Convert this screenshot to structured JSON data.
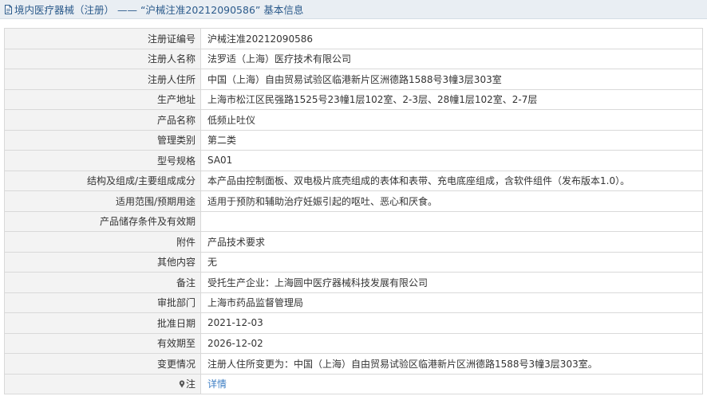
{
  "header": {
    "title": "境内医疗器械（注册） —— “沪械注准20212090586” 基本信息",
    "icon": "document-icon"
  },
  "rows": [
    {
      "label": "注册证编号",
      "value": "沪械注准20212090586"
    },
    {
      "label": "注册人名称",
      "value": "法罗适（上海）医疗技术有限公司"
    },
    {
      "label": "注册人住所",
      "value": "中国（上海）自由贸易试验区临港新片区洲德路1588号3幢3层303室"
    },
    {
      "label": "生产地址",
      "value": "上海市松江区民强路1525号23幢1层102室、2-3层、28幢1层102室、2-7层"
    },
    {
      "label": "产品名称",
      "value": "低频止吐仪"
    },
    {
      "label": "管理类别",
      "value": "第二类"
    },
    {
      "label": "型号规格",
      "value": "SA01"
    },
    {
      "label": "结构及组成/主要组成成分",
      "value": "本产品由控制面板、双电极片底壳组成的表体和表带、充电底座组成，含软件组件（发布版本1.0）。"
    },
    {
      "label": "适用范围/预期用途",
      "value": "适用于预防和辅助治疗妊娠引起的呕吐、恶心和厌食。"
    },
    {
      "label": "产品储存条件及有效期",
      "value": ""
    },
    {
      "label": "附件",
      "value": "产品技术要求"
    },
    {
      "label": "其他内容",
      "value": "无"
    },
    {
      "label": "备注",
      "value": "受托生产企业：上海圆中医疗器械科技发展有限公司"
    },
    {
      "label": "审批部门",
      "value": "上海市药品监督管理局"
    },
    {
      "label": "批准日期",
      "value": "2021-12-03"
    },
    {
      "label": "有效期至",
      "value": "2026-12-02"
    },
    {
      "label": "变更情况",
      "value": "注册人住所变更为：中国（上海）自由贸易试验区临港新片区洲德路1588号3幢3层303室。"
    }
  ],
  "note_row": {
    "label": "注",
    "value": "详情",
    "icon": "pin-icon"
  },
  "colors": {
    "link": "#3f7fc4",
    "title": "#2b5a8b",
    "label_bg": "#f3f3f3",
    "border": "#d9d9d9"
  }
}
